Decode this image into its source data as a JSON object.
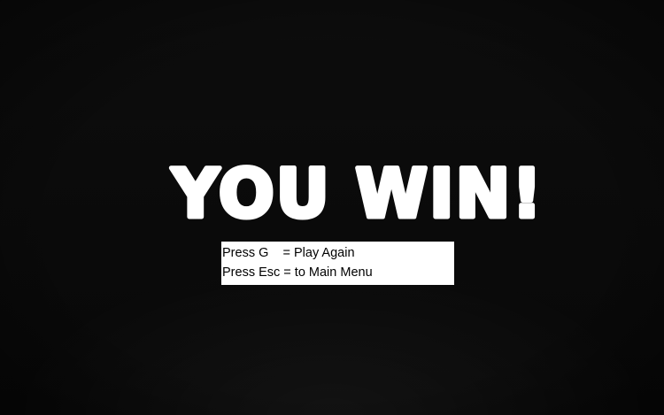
{
  "title": "YOU WIN!",
  "menu": {
    "play_again": "Press G    = Play Again",
    "main_menu": "Press Esc = to Main Menu"
  },
  "colors": {
    "background": "#0b0b0b",
    "title": "#ffffff",
    "menu_box": "#ffffff",
    "menu_text": "#000000"
  }
}
